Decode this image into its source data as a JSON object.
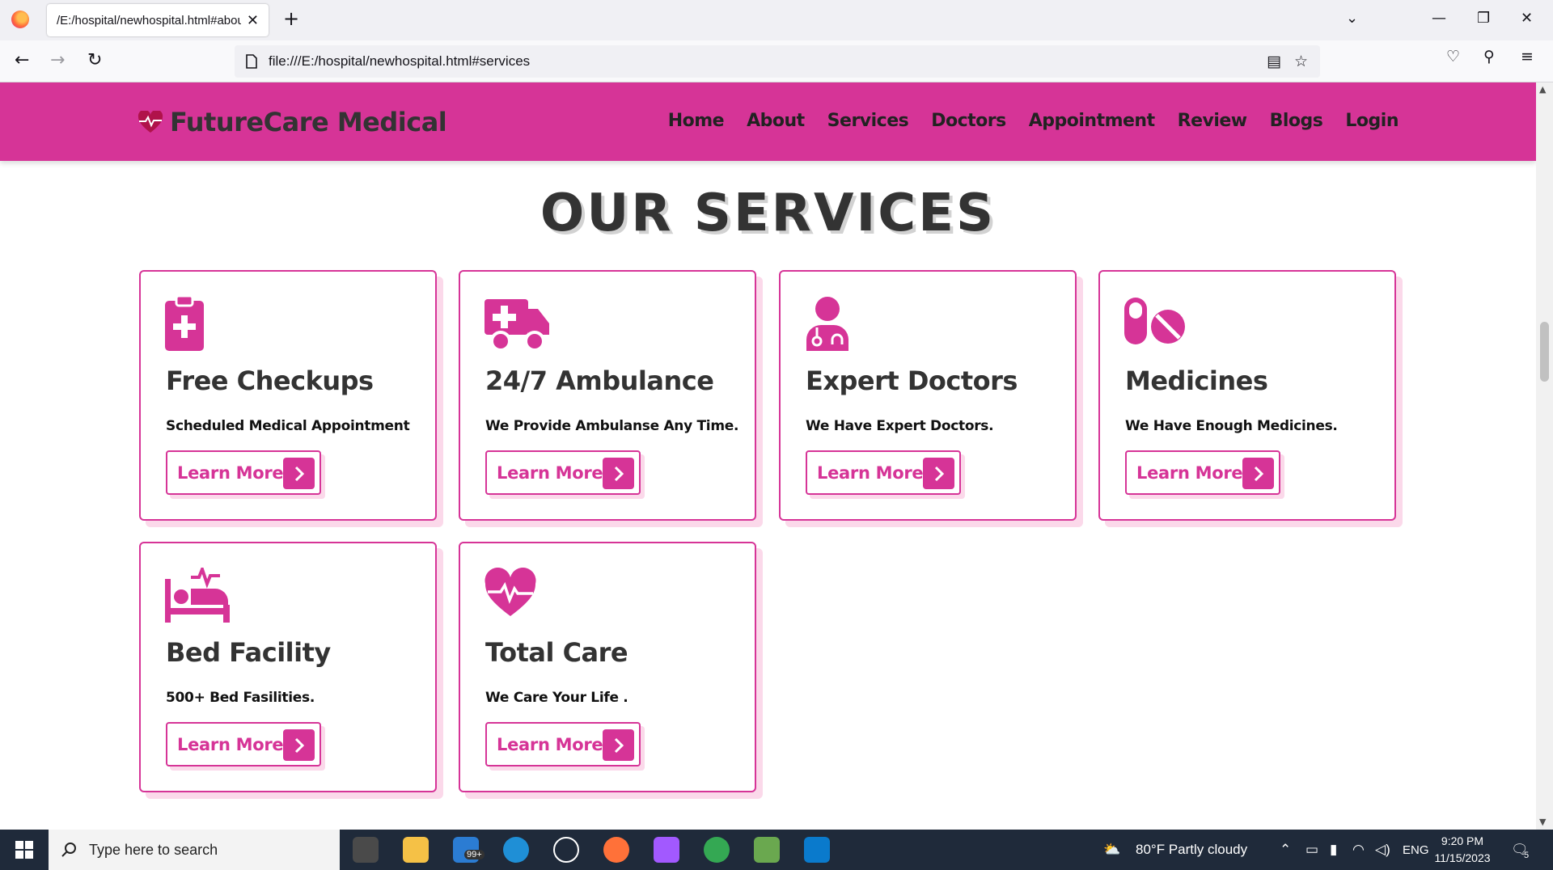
{
  "browser": {
    "tab_title": "/E:/hospital/newhospital.html#about",
    "url": "file:///E:/hospital/newhospital.html#services"
  },
  "site": {
    "brand": "FutureCare Medical",
    "menu": [
      "Home",
      "About",
      "Services",
      "Doctors",
      "Appointment",
      "Review",
      "Blogs",
      "Login"
    ],
    "section_title": "OUR SERVICES",
    "accent_color": "#d63497",
    "services": [
      {
        "icon": "clipboard-medical-icon",
        "title": "Free Checkups",
        "desc": "Scheduled Medical Appointment",
        "button": "Learn More"
      },
      {
        "icon": "ambulance-icon",
        "title": "24/7 Ambulance",
        "desc": "We Provide Ambulanse Any Time.",
        "button": "Learn More"
      },
      {
        "icon": "doctor-icon",
        "title": "Expert Doctors",
        "desc": "We Have Expert Doctors.",
        "button": "Learn More"
      },
      {
        "icon": "pills-icon",
        "title": "Medicines",
        "desc": "We Have Enough Medicines.",
        "button": "Learn More"
      },
      {
        "icon": "bed-pulse-icon",
        "title": "Bed Facility",
        "desc": "500+ Bed Fasilities.",
        "button": "Learn More"
      },
      {
        "icon": "heart-pulse-icon",
        "title": "Total Care",
        "desc": "We Care Your Life .",
        "button": "Learn More"
      }
    ]
  },
  "taskbar": {
    "search_placeholder": "Type here to search",
    "mail_badge": "99+",
    "weather": "80°F  Partly cloudy",
    "language": "ENG",
    "time": "9:20 PM",
    "date": "11/15/2023",
    "notification_count": "5"
  }
}
